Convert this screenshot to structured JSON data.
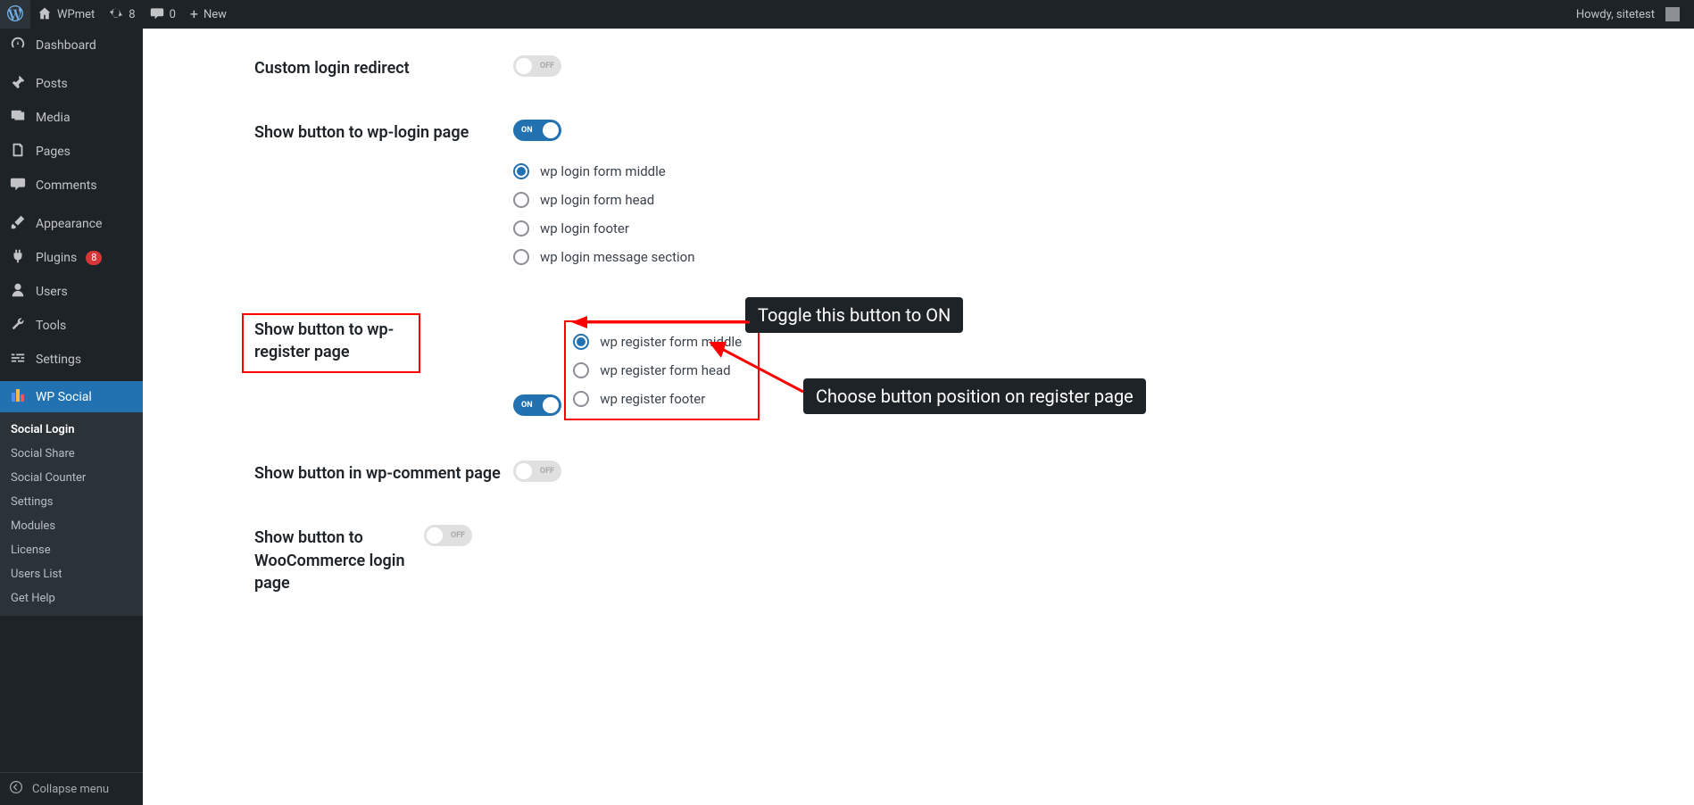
{
  "adminbar": {
    "site_name": "WPmet",
    "updates_count": "8",
    "comments_count": "0",
    "new_label": "New",
    "howdy": "Howdy, sitetest"
  },
  "menu": {
    "dashboard": "Dashboard",
    "posts": "Posts",
    "media": "Media",
    "pages": "Pages",
    "comments": "Comments",
    "appearance": "Appearance",
    "plugins": "Plugins",
    "plugins_badge": "8",
    "users": "Users",
    "tools": "Tools",
    "settings": "Settings",
    "wp_social": "WP Social",
    "collapse": "Collapse menu"
  },
  "submenu": {
    "social_login": "Social Login",
    "social_share": "Social Share",
    "social_counter": "Social Counter",
    "settings": "Settings",
    "modules": "Modules",
    "license": "License",
    "users_list": "Users List",
    "get_help": "Get Help"
  },
  "settings": {
    "custom_login_redirect": {
      "label": "Custom login redirect",
      "state": "OFF"
    },
    "wp_login": {
      "label": "Show button to wp-login page",
      "state": "ON",
      "options": [
        "wp login form middle",
        "wp login form head",
        "wp login footer",
        "wp login message section"
      ],
      "selected": 0
    },
    "wp_register": {
      "label": "Show button to wp-register page",
      "state": "ON",
      "options": [
        "wp register form middle",
        "wp register form head",
        "wp register footer"
      ],
      "selected": 0
    },
    "wp_comment": {
      "label": "Show button in wp-comment page",
      "state": "OFF"
    },
    "woocommerce": {
      "label": "Show button to WooCommerce login page",
      "state": "OFF"
    }
  },
  "callouts": {
    "toggle": "Toggle this button to ON",
    "position": "Choose button position on register page"
  }
}
